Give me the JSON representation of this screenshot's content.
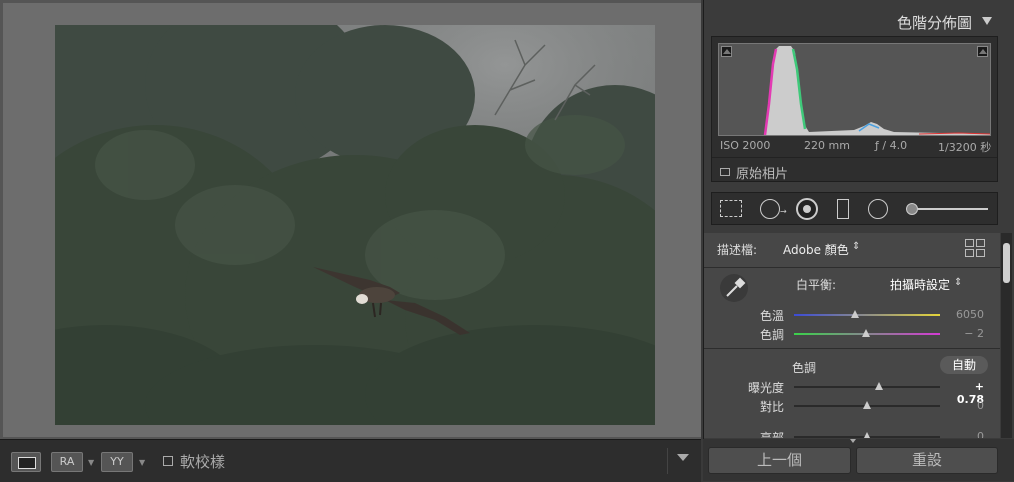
{
  "histogram": {
    "title": "色階分佈圖",
    "iso": "ISO 2000",
    "focal": "220 mm",
    "aperture": "ƒ / 4.0",
    "shutter": "1/3200 秒",
    "original_label": "原始相片"
  },
  "basic": {
    "profile_label": "描述檔:",
    "profile_value": "Adobe 顏色",
    "wb_label": "白平衡:",
    "wb_value": "拍攝時設定",
    "temp_label": "色溫",
    "temp_value": "6050",
    "temp_level": 0.42,
    "tint_label": "色調",
    "tint_value": "− 2",
    "tint_level": 0.49,
    "tone_title": "色調",
    "auto_label": "自動",
    "exposure_label": "曝光度",
    "exposure_value": "+ 0.78",
    "exposure_level": 0.58,
    "contrast_label": "對比",
    "contrast_value": "0",
    "contrast_level": 0.5,
    "highlights_label": "亮部",
    "highlights_value": "0",
    "highlights_level": 0.5
  },
  "buttons": {
    "previous": "上一個",
    "reset": "重設"
  },
  "toolbar": {
    "ra_label": "RA",
    "yy_label": "YY",
    "softproof_label": "軟校樣"
  },
  "colors": {
    "panel_bg": "#3b3b3b",
    "canvas_bg": "#6d6d6d",
    "temp_gradient": [
      "#3b4bd6",
      "#e4d43a"
    ],
    "tint_gradient": [
      "#3ad24a",
      "#d43ad4"
    ]
  },
  "icons": [
    "crop-icon",
    "spot-removal-icon",
    "red-eye-icon",
    "graduated-filter-icon",
    "radial-filter-icon",
    "adjustment-brush-icon",
    "eyedropper-icon",
    "grid-icon",
    "loupe-view-icon"
  ]
}
